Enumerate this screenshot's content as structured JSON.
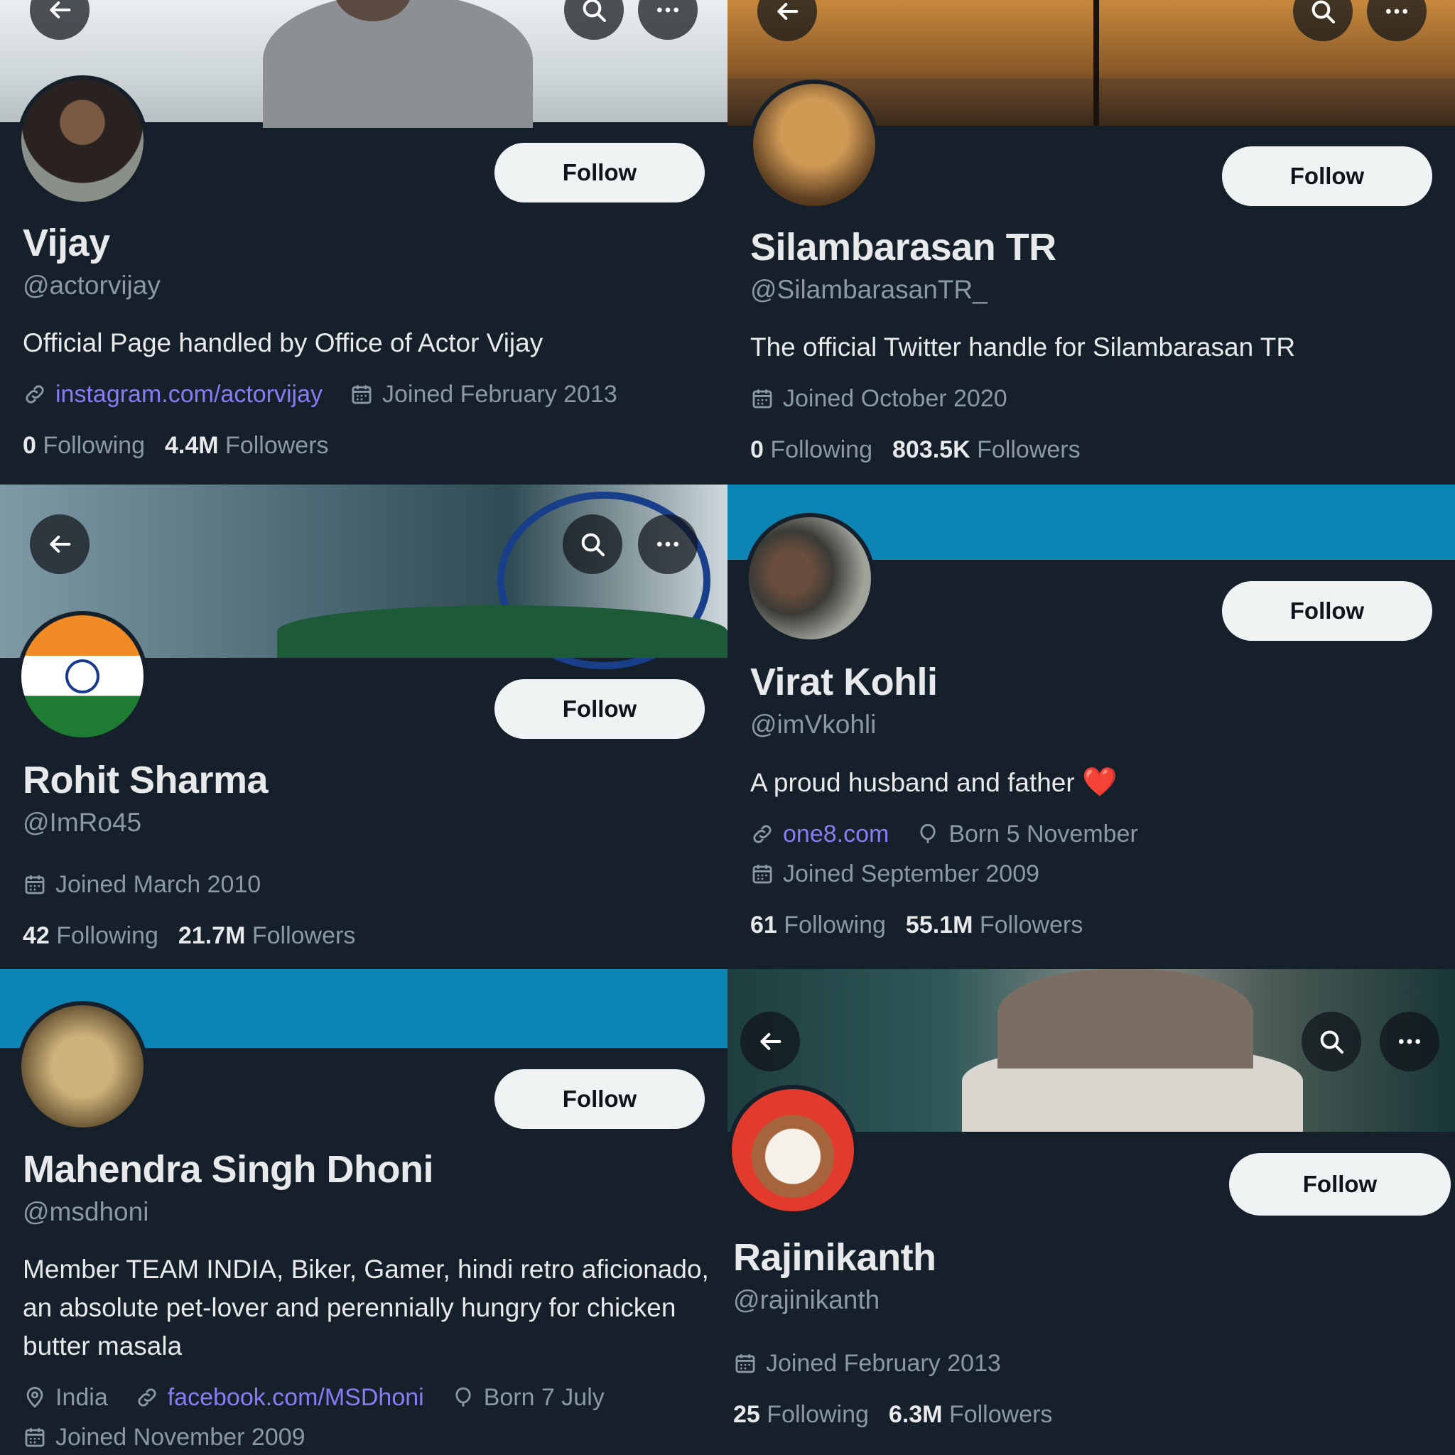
{
  "profiles": [
    {
      "name": "Vijay",
      "handle": "@actorvijay",
      "bio": "Official Page handled by Office of Actor Vijay",
      "link": "instagram.com/actorvijay",
      "joined": "Joined February 2013",
      "following": "0",
      "followers": "4.4M",
      "follow_label": "Follow"
    },
    {
      "name": "Silambarasan TR",
      "handle": "@SilambarasanTR_",
      "bio": "The official Twitter handle for Silambarasan TR",
      "joined": "Joined October 2020",
      "following": "0",
      "followers": "803.5K",
      "follow_label": "Follow"
    },
    {
      "name": "Rohit Sharma",
      "handle": "@ImRo45",
      "joined": "Joined March 2010",
      "following": "42",
      "followers": "21.7M",
      "follow_label": "Follow"
    },
    {
      "name": "Virat Kohli",
      "handle": "@imVkohli",
      "bio": "A proud husband and father",
      "bio_emoji": "❤️",
      "link": "one8.com",
      "born": "Born 5 November",
      "joined": "Joined September 2009",
      "following": "61",
      "followers": "55.1M",
      "follow_label": "Follow"
    },
    {
      "name": "Mahendra Singh Dhoni",
      "handle": "@msdhoni",
      "bio": "Member TEAM INDIA, Biker, Gamer, hindi retro aficionado, an absolute pet-lover and perennially hungry for chicken butter masala",
      "location": "India",
      "link": "facebook.com/MSDhoni",
      "born": "Born 7 July",
      "joined": "Joined November 2009",
      "follow_label": "Follow"
    },
    {
      "name": "Rajinikanth",
      "handle": "@rajinikanth",
      "joined": "Joined February 2013",
      "following": "25",
      "followers": "6.3M",
      "follow_label": "Follow"
    }
  ],
  "labels": {
    "following": "Following",
    "followers": "Followers"
  },
  "icons": [
    "back-arrow-icon",
    "search-icon",
    "more-icon",
    "link-icon",
    "calendar-icon",
    "location-icon",
    "balloon-icon"
  ],
  "colors": {
    "background": "#16202b",
    "link": "#8a7bf5",
    "muted": "#8b98a5",
    "follow_button": "#eff3f4",
    "blue_banner": "#0c85b4"
  }
}
